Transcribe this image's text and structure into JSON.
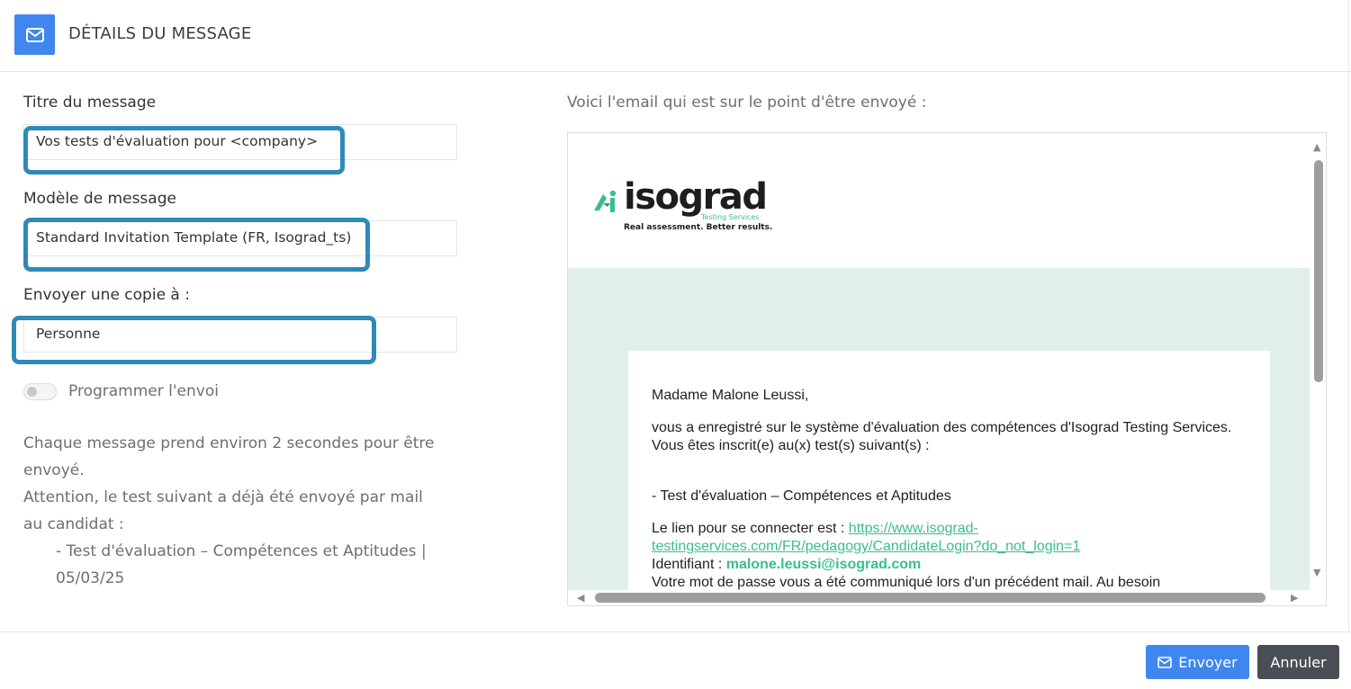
{
  "header": {
    "title": "DÉTAILS DU MESSAGE",
    "icon": "envelope-icon"
  },
  "form": {
    "title_label": "Titre du message",
    "title_value": "Vos tests d'évaluation pour <company>",
    "template_label": "Modèle de message",
    "template_value": "Standard Invitation Template (FR, Isograd_ts)",
    "copy_label": "Envoyer une copie à :",
    "copy_value": "Personne",
    "schedule_label": "Programmer l'envoi",
    "schedule_enabled": false
  },
  "info": {
    "line1": "Chaque message prend environ 2 secondes pour être envoyé.",
    "line2": "Attention, le test suivant a déjà été envoyé par mail au candidat :",
    "item": "- Test d'évaluation – Compétences et Aptitudes | 05/03/25"
  },
  "preview": {
    "caption": "Voici l'email qui est sur le point d'être envoyé :",
    "logo": {
      "word": "isograd",
      "sub": "Testing Services",
      "tagline": "Real assessment. Better results."
    },
    "greeting": "Madame Malone Leussi,",
    "intro": "vous a enregistré sur le système d'évaluation des compétences d'Isograd Testing Services. Vous êtes inscrit(e) au(x) test(s) suivant(s) :",
    "test_item": "- Test d'évaluation – Compétences et Aptitudes",
    "link_prefix": "Le lien pour se connecter est : ",
    "link": "https://www.isograd-testingservices.com/FR/pedagogy/CandidateLogin?do_not_login=1",
    "id_prefix": "Identifiant : ",
    "id_value": "malone.leussi@isograd.com",
    "password_line": "Votre mot de passe vous a été communiqué lors d'un précédent mail. Au besoin"
  },
  "footer": {
    "send_label": "Envoyer",
    "cancel_label": "Annuler"
  },
  "colors": {
    "accent": "#3f87ef",
    "highlight": "#2e8ab8",
    "brand_green": "#3bbd8f",
    "mail_bg": "#e1efea"
  }
}
